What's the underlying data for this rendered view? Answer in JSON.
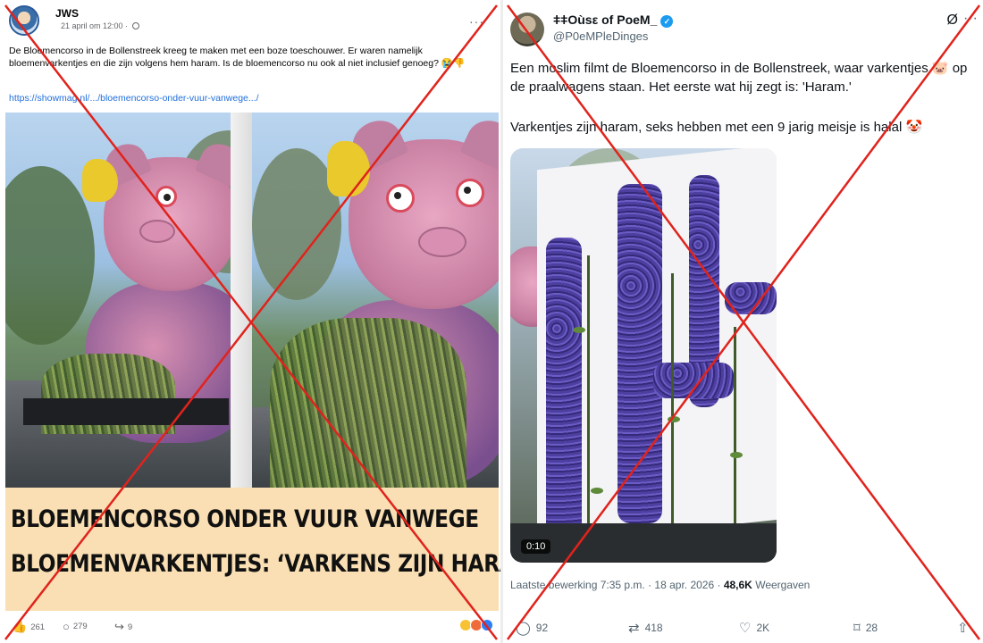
{
  "left_post": {
    "author": "JWS",
    "date": "21 april om 12:00 ·",
    "body": "De Bloemencorso in de Bollenstreek kreeg te maken met een boze toeschouwer. Er waren namelijk bloemenvarkentjes en die zijn volgens hem haram. Is de bloemencorso nu ook al niet inclusief genoeg? 😭👎",
    "link": "https://showmag.nl/.../bloemencorso-onder-vuur-vanwege.../",
    "banner_line1": "BLOEMENCORSO ONDER VUUR VANWEGE",
    "banner_line2": "BLOEMENVARKENTJES: ‘VARKENS ZIJN HARAM’",
    "likes": "261",
    "comments": "279",
    "shares": "9",
    "icons": [
      "globe-icon",
      "more-icon",
      "like-icon",
      "comment-icon",
      "share-icon"
    ]
  },
  "right_post": {
    "display_name": "ǂǂOùsε of PoeM_",
    "handle": "@P0eMPleDinges",
    "text_line1": "Een moslim filmt de Bloemencorso in de Bollenstreek, waar varkentjes 🐷 op de praalwagens staan. Het eerste wat hij zegt is: 'Haram.'",
    "text_line2": "Varkentjes zijn haram, seks hebben met een 9 jarig meisje is halal 🤡",
    "video_duration": "0:10",
    "edited": "Laatste bewerking 7:35 p.m. · 18 apr. 2026 ·",
    "views": "48,6K",
    "views_label": "Weergaven",
    "replies": "92",
    "reposts": "418",
    "likes": "2K",
    "bookmarks": "28",
    "icons": [
      "verified-icon",
      "grok-icon",
      "more-icon",
      "reply-icon",
      "repost-icon",
      "like-icon",
      "bookmark-icon",
      "share-icon"
    ]
  },
  "colors": {
    "cross": "#e0231c",
    "link": "#216fdb",
    "verified": "#1d9bf0",
    "banner_bg": "#f9dfb3"
  }
}
